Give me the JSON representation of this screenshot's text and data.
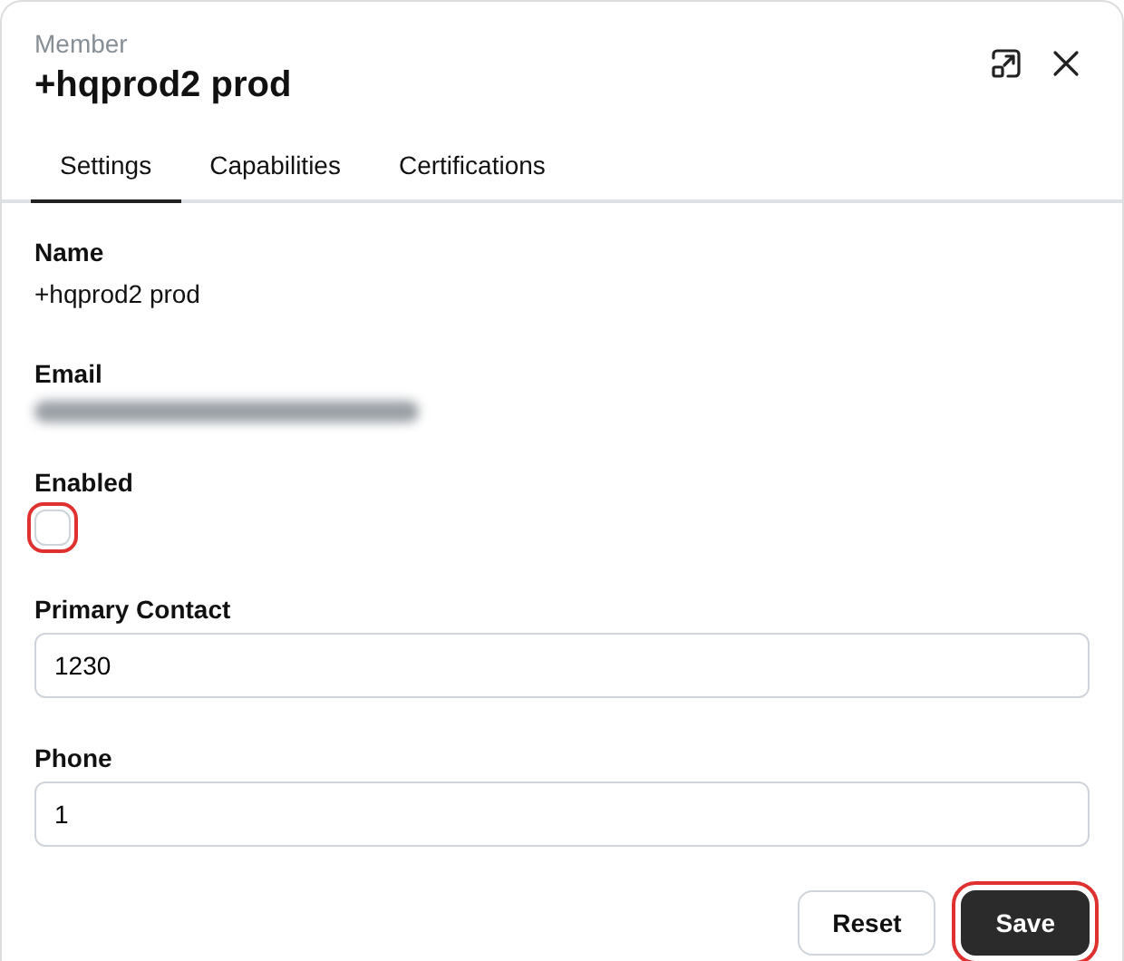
{
  "header": {
    "subtitle": "Member",
    "title": "+hqprod2 prod"
  },
  "tabs": [
    {
      "label": "Settings",
      "selected": true
    },
    {
      "label": "Capabilities",
      "selected": false
    },
    {
      "label": "Certifications",
      "selected": false
    }
  ],
  "fields": [
    {
      "kind": "text",
      "label": "Name",
      "value": "+hqprod2 prod"
    },
    {
      "kind": "redacted",
      "label": "Email"
    },
    {
      "kind": "checkbox",
      "label": "Enabled",
      "checked": false,
      "highlighted": true
    },
    {
      "kind": "input",
      "label": "Primary Contact",
      "value": "1230"
    },
    {
      "kind": "input",
      "label": "Phone",
      "value": "1"
    }
  ],
  "buttons": [
    {
      "label": "Reset",
      "kind": "secondary",
      "highlighted": false
    },
    {
      "label": "Save",
      "kind": "primary",
      "highlighted": true
    }
  ]
}
